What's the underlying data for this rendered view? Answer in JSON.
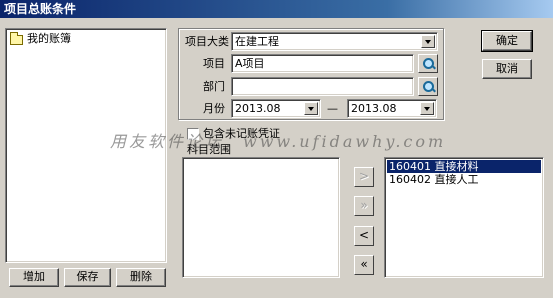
{
  "window": {
    "title": "项目总账条件"
  },
  "tree": {
    "root_label": "我的账簿"
  },
  "left_buttons": {
    "add": "增加",
    "save": "保存",
    "delete": "删除"
  },
  "form": {
    "category_label": "项目大类",
    "category_value": "在建工程",
    "project_label": "项目",
    "project_value": "A项目",
    "department_label": "部门",
    "department_value": "",
    "month_label": "月份",
    "month_from": "2013.08",
    "month_separator": "—",
    "month_to": "2013.08"
  },
  "actions": {
    "ok": "确定",
    "cancel": "取消"
  },
  "include_unposted": {
    "label": "包含未记账凭证",
    "checked": false
  },
  "subject_range": {
    "label": "科目范围"
  },
  "selected_subjects": [
    {
      "code": "160401",
      "name": "直接材料",
      "selected": true
    },
    {
      "code": "160402",
      "name": "直接人工",
      "selected": false
    }
  ],
  "transfer_buttons": {
    "add_one": ">",
    "add_all": "»",
    "remove_one": "<",
    "remove_all": "«"
  },
  "watermark": {
    "text": "用友软件论坛：www.ufidawhy.com"
  }
}
